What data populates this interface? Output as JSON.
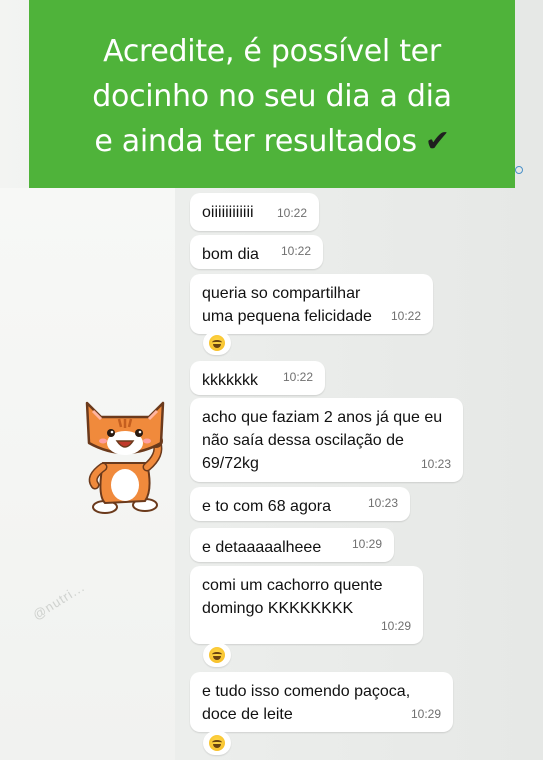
{
  "banner": {
    "line1": "Acredite, é possível ter",
    "line2": "docinho no seu dia a dia",
    "line3": "e ainda ter resultados",
    "check": "✔",
    "bg_color": "#4fb33a"
  },
  "watermark": "@nutri...",
  "sticker": {
    "icon": "cat-sticker-icon"
  },
  "messages": [
    {
      "text": "oiiiiiiiiiiii",
      "time": "10:22"
    },
    {
      "text": "bom dia",
      "time": "10:22"
    },
    {
      "text": "queria so compartilhar uma pequena felicidade",
      "time": "10:22",
      "reaction": "grinning-sweat-emoji"
    },
    {
      "text": "kkkkkkk",
      "time": "10:22"
    },
    {
      "text": "acho que faziam 2 anos já que eu não saía dessa oscilação de 69/72kg",
      "time": "10:23"
    },
    {
      "text": "e to com 68 agora",
      "time": "10:23"
    },
    {
      "text": "e detaaaaalheee",
      "time": "10:29"
    },
    {
      "text": "comi um cachorro quente domingo KKKKKKKK",
      "time": "10:29",
      "reaction": "grinning-sweat-emoji"
    },
    {
      "text": "e tudo isso comendo paçoca, doce de leite",
      "time": "10:29",
      "reaction": "grinning-sweat-emoji"
    }
  ]
}
